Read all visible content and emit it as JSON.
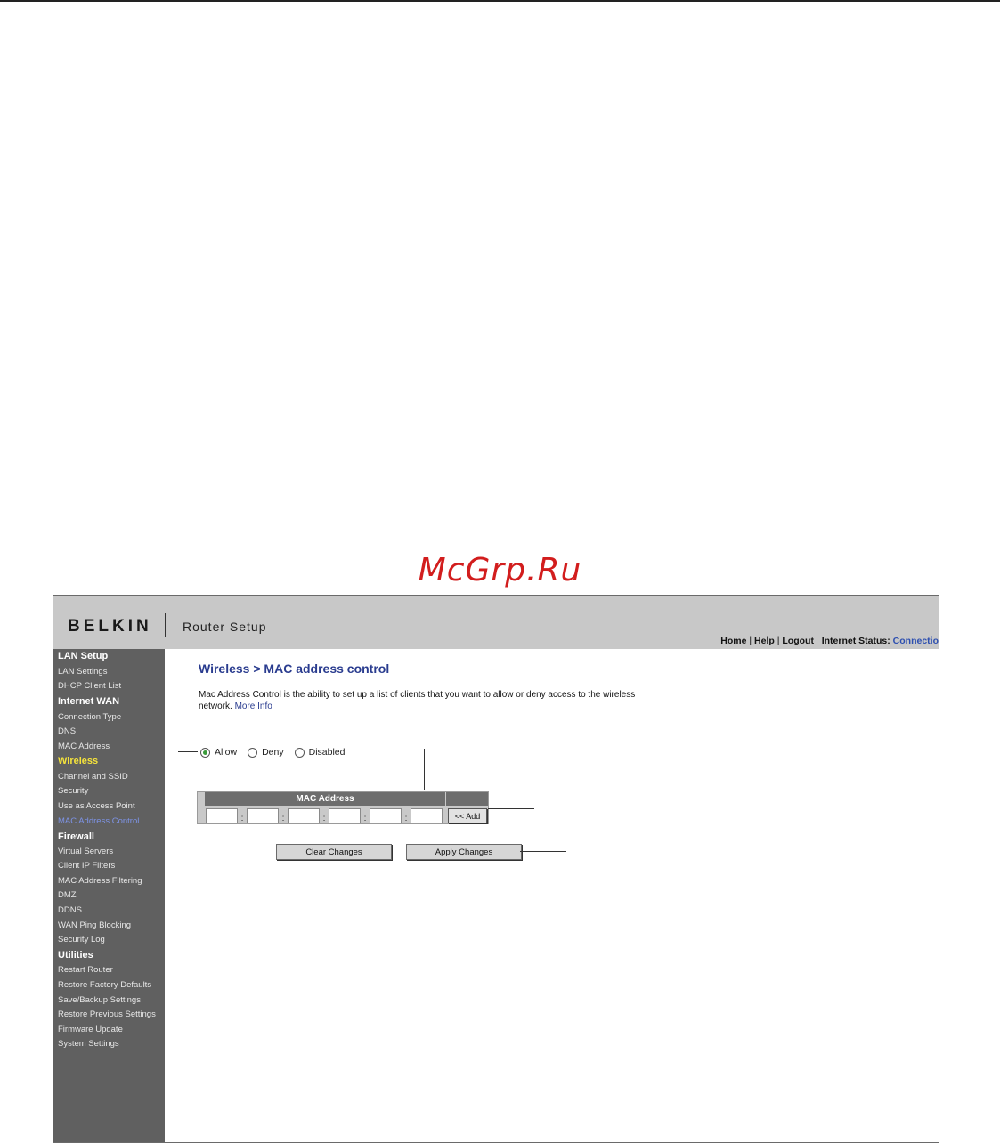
{
  "watermark": "McGrp.Ru",
  "header": {
    "brand": "BELKIN",
    "subtitle": "Router Setup",
    "links": {
      "home": "Home",
      "help": "Help",
      "logout": "Logout"
    },
    "status_label": "Internet Status:",
    "status_value": "Connectio"
  },
  "sidebar": {
    "sections": [
      {
        "title": "LAN Setup",
        "items": [
          "LAN Settings",
          "DHCP Client List"
        ]
      },
      {
        "title": "Internet WAN",
        "items": [
          "Connection Type",
          "DNS",
          "MAC Address"
        ]
      },
      {
        "title": "Wireless",
        "items": [
          "Channel and SSID",
          "Security",
          "Use as Access Point",
          "MAC Address Control"
        ]
      },
      {
        "title": "Firewall",
        "items": [
          "Virtual Servers",
          "Client IP Filters",
          "MAC Address Filtering",
          "DMZ",
          "DDNS",
          "WAN Ping Blocking",
          "Security Log"
        ]
      },
      {
        "title": "Utilities",
        "items": [
          "Restart Router",
          "Restore Factory Defaults",
          "Save/Backup Settings",
          "Restore Previous Settings",
          "Firmware Update",
          "System Settings"
        ]
      }
    ],
    "active_section": "Wireless",
    "current_item": "MAC Address Control"
  },
  "main": {
    "title": "Wireless > MAC address control",
    "description": "Mac Address Control is the ability to set up a list of clients that you want to allow or deny access to the wireless network.",
    "more_info": "More Info",
    "radios": [
      {
        "label": "Allow",
        "checked": true
      },
      {
        "label": "Deny",
        "checked": false
      },
      {
        "label": "Disabled",
        "checked": false
      }
    ],
    "mac_table": {
      "header": "MAC Address",
      "fields": [
        "",
        "",
        "",
        "",
        "",
        ""
      ],
      "add_label": "<< Add"
    },
    "clear_label": "Clear Changes",
    "apply_label": "Apply Changes"
  }
}
